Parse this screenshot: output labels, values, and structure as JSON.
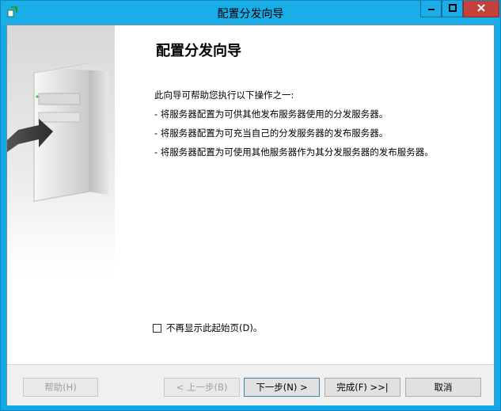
{
  "window": {
    "title": "配置分发向导"
  },
  "titlebar": {
    "app_icon": "wizard-app-icon",
    "minimize_icon": "minimize-icon",
    "maximize_icon": "maximize-icon",
    "close_icon": "close-icon"
  },
  "content": {
    "heading": "配置分发向导",
    "intro": "此向导可帮助您执行以下操作之一:",
    "operations": [
      "- 将服务器配置为可供其他发布服务器使用的分发服务器。",
      "- 将服务器配置为可充当自己的分发服务器的发布服务器。",
      "- 将服务器配置为可使用其他服务器作为其分发服务器的发布服务器。"
    ],
    "checkbox_label": "不再显示此起始页(D)。",
    "checkbox_checked": false
  },
  "buttons": {
    "help": "帮助(H)",
    "back": "< 上一步(B)",
    "next": "下一步(N) >",
    "finish": "完成(F) >>|",
    "cancel": "取消"
  },
  "colors": {
    "titlebar": "#1aaee9",
    "close_button": "#c7413b",
    "side_panel_gray": "#d8d8d8"
  }
}
